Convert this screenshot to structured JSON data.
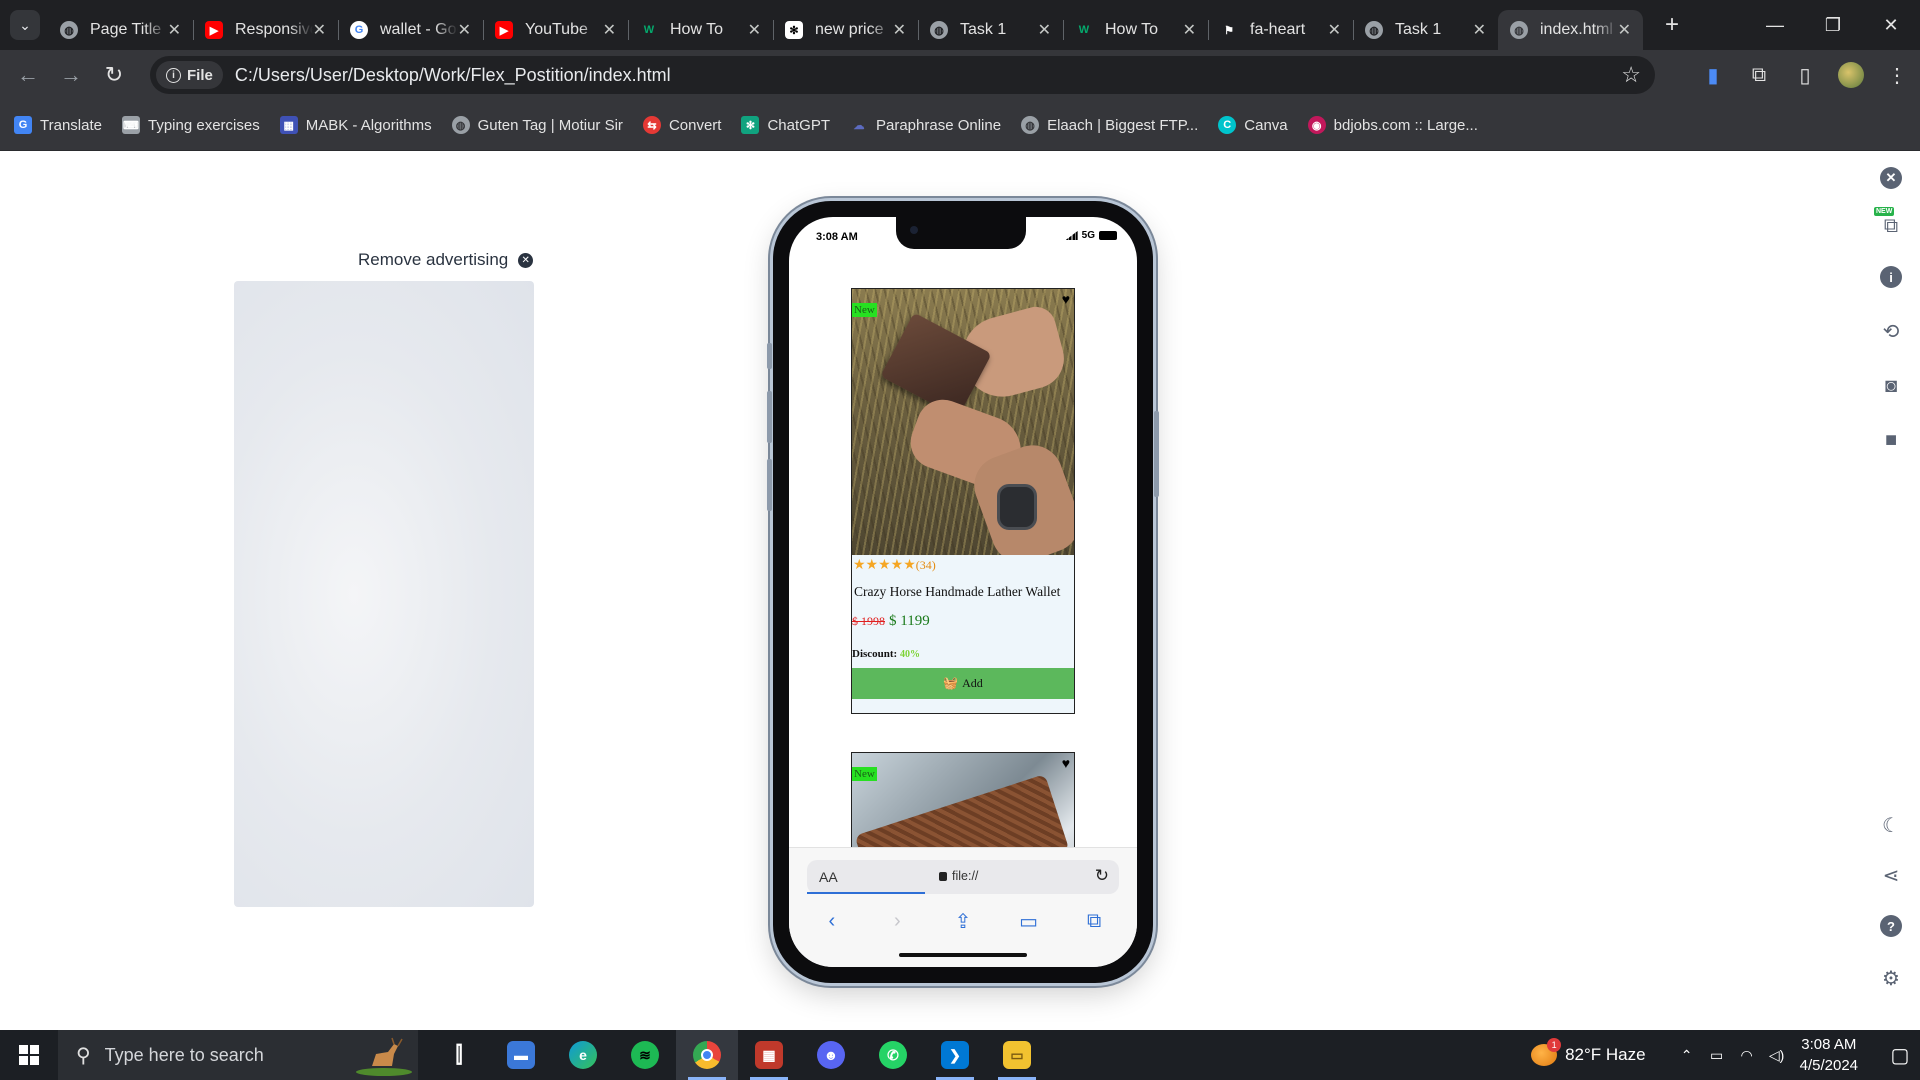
{
  "browser": {
    "tabs": [
      {
        "title": "Page Title",
        "favicon": "globe-icon",
        "active": false
      },
      {
        "title": "Responsive",
        "favicon": "youtube-icon",
        "active": false
      },
      {
        "title": "wallet - Google",
        "favicon": "google-icon",
        "active": false
      },
      {
        "title": "YouTube",
        "favicon": "youtube-icon",
        "active": false
      },
      {
        "title": "How To",
        "favicon": "w-icon",
        "active": false
      },
      {
        "title": "new price",
        "favicon": "openai-icon",
        "active": false
      },
      {
        "title": "Task 1",
        "favicon": "globe-icon",
        "active": false
      },
      {
        "title": "How To",
        "favicon": "w-icon",
        "active": false
      },
      {
        "title": "fa-heart",
        "favicon": "flag-icon",
        "active": false
      },
      {
        "title": "Task 1",
        "favicon": "globe-icon",
        "active": false
      },
      {
        "title": "index.html",
        "favicon": "globe-icon",
        "active": true
      }
    ],
    "address": {
      "scheme_chip": "File",
      "url": "C:/Users/User/Desktop/Work/Flex_Postition/index.html"
    },
    "bookmarks": [
      {
        "label": "Translate",
        "icon": "translate-icon",
        "color": "#4285f4"
      },
      {
        "label": "Typing exercises",
        "icon": "keyboard-icon",
        "color": "#9aa0a6"
      },
      {
        "label": "MABK - Algorithms",
        "icon": "grid-icon",
        "color": "#3f51b5"
      },
      {
        "label": "Guten Tag | Motiur Sir",
        "icon": "globe-icon",
        "color": "#9aa0a6"
      },
      {
        "label": "Convert",
        "icon": "convert-icon",
        "color": "#e53935"
      },
      {
        "label": "ChatGPT",
        "icon": "openai-icon",
        "color": "#10a37f"
      },
      {
        "label": "Paraphrase Online",
        "icon": "cloud-icon",
        "color": "#5c6bc0"
      },
      {
        "label": "Elaach | Biggest FTP...",
        "icon": "globe-icon",
        "color": "#9aa0a6"
      },
      {
        "label": "Canva",
        "icon": "canva-icon",
        "color": "#00c4cc"
      },
      {
        "label": "bdjobs.com :: Large...",
        "icon": "bdjobs-icon",
        "color": "#c2185b"
      }
    ]
  },
  "page": {
    "remove_advertising": "Remove advertising"
  },
  "phone": {
    "time": "3:08 AM",
    "network": "5G",
    "products": [
      {
        "badge": "New",
        "rating_count": "(34)",
        "stars": 5,
        "name": "Crazy Horse Handmade Lather Wallet",
        "old_price": "$ 1998",
        "new_price": "$ 1199",
        "discount_label": "Discount:",
        "discount_value": "40%",
        "button": "Add"
      },
      {
        "badge": "New"
      }
    ],
    "safari": {
      "aa": "AA",
      "url": "file://"
    }
  },
  "taskbar": {
    "search_placeholder": "Type here to search",
    "weather": "82°F  Haze",
    "weather_badge": "1",
    "time": "3:08 AM",
    "date": "4/5/2024",
    "apps": [
      {
        "name": "task-view",
        "color": "#2b2e33",
        "label": "⊞"
      },
      {
        "name": "network-app",
        "color": "#3b78d8",
        "label": "🖥"
      },
      {
        "name": "edge",
        "color": "#0f9ad6",
        "label": "e"
      },
      {
        "name": "spotify",
        "color": "#1db954",
        "label": "♫"
      },
      {
        "name": "chrome",
        "color": "#e8453c",
        "label": "◉"
      },
      {
        "name": "media-app",
        "color": "#c0392b",
        "label": "▦"
      },
      {
        "name": "discord",
        "color": "#5865f2",
        "label": "☻"
      },
      {
        "name": "whatsapp",
        "color": "#25d366",
        "label": "✆"
      },
      {
        "name": "vscode",
        "color": "#0078d4",
        "label": "❯"
      },
      {
        "name": "file-explorer",
        "color": "#f2c230",
        "label": "▭"
      }
    ]
  }
}
